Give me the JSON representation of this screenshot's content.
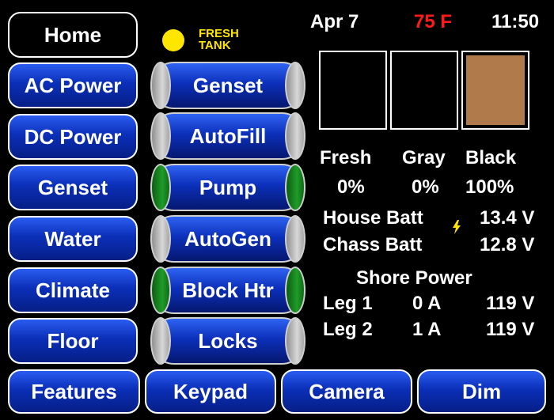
{
  "header": {
    "date": "Apr 7",
    "temperature": "75 F",
    "time": "11:50",
    "temp_color": "#ff1a1a"
  },
  "indicator": {
    "label_line1": "FRESH",
    "label_line2": "TANK",
    "color": "#ffe600"
  },
  "nav": {
    "home": "Home",
    "items": [
      "AC Power",
      "DC Power",
      "Genset",
      "Water",
      "Climate",
      "Floor"
    ]
  },
  "toggles": [
    {
      "label": "Genset",
      "state": "off"
    },
    {
      "label": "AutoFill",
      "state": "off"
    },
    {
      "label": "Pump",
      "state": "on"
    },
    {
      "label": "AutoGen",
      "state": "off"
    },
    {
      "label": "Block Htr",
      "state": "on"
    },
    {
      "label": "Locks",
      "state": "off"
    }
  ],
  "bottom": {
    "features": "Features",
    "keypad": "Keypad",
    "camera": "Camera",
    "dim": "Dim"
  },
  "tanks": {
    "fresh": {
      "label": "Fresh",
      "value": "0%",
      "level": 0
    },
    "gray": {
      "label": "Gray",
      "value": "0%",
      "level": 0
    },
    "black": {
      "label": "Black",
      "value": "100%",
      "level": 1.0,
      "fill_color": "#b07a4a"
    }
  },
  "batteries": {
    "house_label": "House Batt",
    "house_value": "13.4 V",
    "chassis_label": "Chass Batt",
    "chassis_value": "12.8 V",
    "charging_icon": "lightning-icon"
  },
  "shore": {
    "title": "Shore Power",
    "leg1_label": "Leg 1",
    "leg1_amps": "0 A",
    "leg1_volts": "119 V",
    "leg2_label": "Leg 2",
    "leg2_amps": "1 A",
    "leg2_volts": "119 V"
  }
}
